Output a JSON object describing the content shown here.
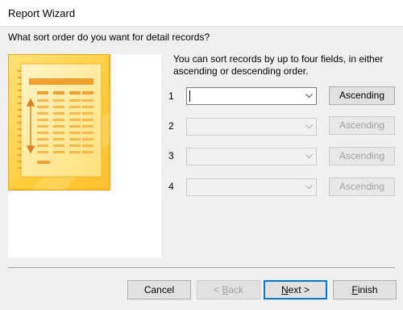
{
  "window": {
    "title": "Report Wizard"
  },
  "question": "What sort order do you want for detail records?",
  "instructions": "You can sort records by up to four fields, in either ascending or descending order.",
  "sort_rows": [
    {
      "number": "1",
      "field_value": "",
      "order_label": "Ascending",
      "enabled": true
    },
    {
      "number": "2",
      "field_value": "",
      "order_label": "Ascending",
      "enabled": false
    },
    {
      "number": "3",
      "field_value": "",
      "order_label": "Ascending",
      "enabled": false
    },
    {
      "number": "4",
      "field_value": "",
      "order_label": "Ascending",
      "enabled": false
    }
  ],
  "footer": {
    "cancel": "Cancel",
    "back_pre": "< ",
    "back_ul": "B",
    "back_post": "ack",
    "next_ul": "N",
    "next_post": "ext >",
    "finish_ul": "F",
    "finish_post": "inish"
  },
  "colors": {
    "accent": "#0078d7",
    "preview_fill": "#ffd24a",
    "preview_border": "#f2a61c",
    "preview_lines": "#f08a1c"
  },
  "icons": {
    "preview": "report-preview-illustration",
    "dropdown": "chevron-down-icon"
  }
}
